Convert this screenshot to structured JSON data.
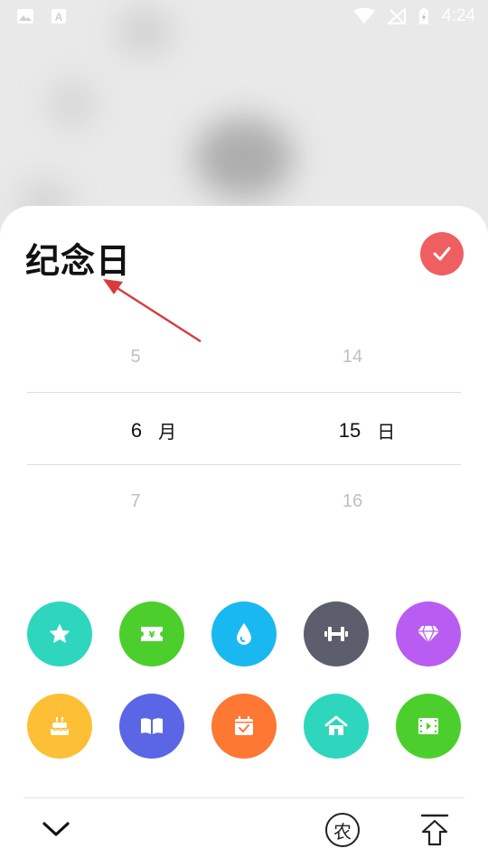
{
  "status_bar": {
    "time": "4:24",
    "left_icons": [
      "image-icon",
      "font-icon"
    ],
    "right_icons": [
      "wifi-icon",
      "no-signal-icon",
      "battery-charging-icon"
    ]
  },
  "sheet": {
    "title": "纪念日"
  },
  "picker": {
    "month": {
      "prev": "5",
      "selected": "6",
      "next": "7",
      "unit": "月"
    },
    "day": {
      "prev": "14",
      "selected": "15",
      "next": "16",
      "unit": "日"
    }
  },
  "categories": [
    {
      "icon": "star-icon",
      "color": "#2fd6be"
    },
    {
      "icon": "money-ticket-icon",
      "color": "#4ccf2c"
    },
    {
      "icon": "water-drop-icon",
      "color": "#1ab8f0"
    },
    {
      "icon": "dumbbell-icon",
      "color": "#5c5f6b"
    },
    {
      "icon": "diamond-icon",
      "color": "#b85cf2"
    },
    {
      "icon": "cake-icon",
      "color": "#fdbf35"
    },
    {
      "icon": "book-icon",
      "color": "#5a66e6"
    },
    {
      "icon": "calendar-check-icon",
      "color": "#fe7733"
    },
    {
      "icon": "home-icon",
      "color": "#2fd6be"
    },
    {
      "icon": "video-icon",
      "color": "#4ccf2c"
    }
  ],
  "bottom_bar": {
    "lunar_glyph": "农"
  },
  "colors": {
    "accent": "#ef5f62",
    "annotation_arrow": "#d93b3b"
  }
}
